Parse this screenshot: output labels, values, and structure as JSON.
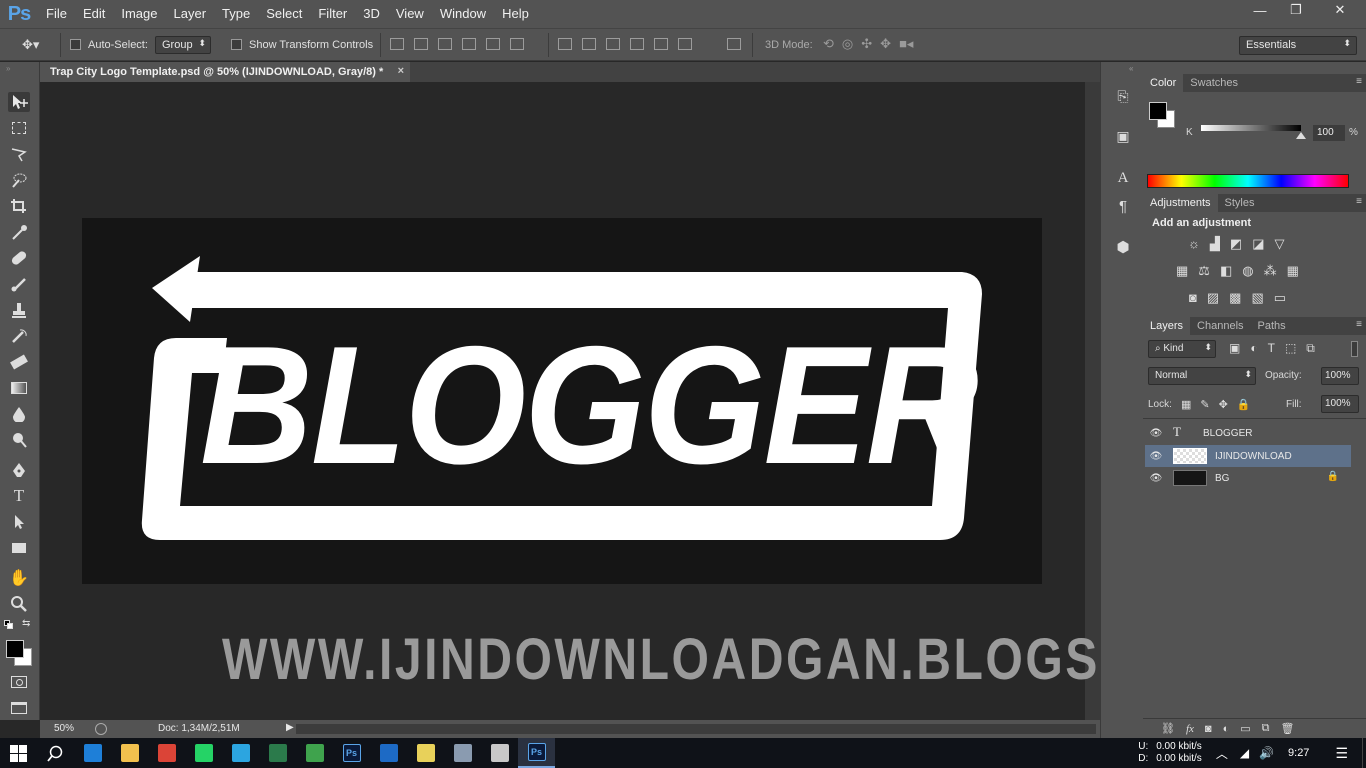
{
  "app": {
    "logo": "Ps"
  },
  "menu": [
    "File",
    "Edit",
    "Image",
    "Layer",
    "Type",
    "Select",
    "Filter",
    "3D",
    "View",
    "Window",
    "Help"
  ],
  "window_controls": {
    "minimize": "—",
    "restore": "❐",
    "close": "✕"
  },
  "options_bar": {
    "auto_select_label": "Auto-Select:",
    "auto_select_value": "Group",
    "show_transform_label": "Show Transform Controls",
    "mode_3d_label": "3D Mode:",
    "workspace": "Essentials"
  },
  "document": {
    "tab_title": "Trap City Logo Template.psd @ 50% (IJINDOWNLOAD, Gray/8) *",
    "tab_close": "×",
    "logo_text": "BLOGGER",
    "watermark": "WWW.IJINDOWNLOADGAN.BLOGSPOT.COM"
  },
  "status_bar": {
    "zoom": "50%",
    "doc_info": "Doc: 1,34M/2,51M"
  },
  "color_panel": {
    "tabs": [
      "Color",
      "Swatches"
    ],
    "channel": "K",
    "value": "100",
    "unit": "%",
    "foreground": "#000000",
    "background": "#ffffff"
  },
  "adjustments_panel": {
    "tabs": [
      "Adjustments",
      "Styles"
    ],
    "heading": "Add an adjustment"
  },
  "layers_panel": {
    "tabs": [
      "Layers",
      "Channels",
      "Paths"
    ],
    "filter_kind": "Kind",
    "blend_mode": "Normal",
    "opacity_label": "Opacity:",
    "opacity": "100%",
    "lock_label": "Lock:",
    "fill_label": "Fill:",
    "fill": "100%",
    "layers": [
      {
        "name": "BLOGGER",
        "kind": "text",
        "thumb": "T",
        "selected": false,
        "locked": false
      },
      {
        "name": "IJINDOWNLOAD",
        "kind": "image",
        "thumb": "",
        "selected": true,
        "locked": false
      },
      {
        "name": "BG",
        "kind": "image",
        "thumb": "",
        "selected": false,
        "locked": true
      }
    ],
    "footer_fx": "fx"
  },
  "taskbar": {
    "network_up_label": "U:",
    "network_down_label": "D:",
    "network_up": "0.00 kbit/s",
    "network_down": "0.00 kbit/s",
    "time": "9:27",
    "pinned": [
      {
        "name": "search",
        "color": "#0f1218"
      },
      {
        "name": "edge",
        "color": "#1e7fd8"
      },
      {
        "name": "file-explorer",
        "color": "#f2c14e"
      },
      {
        "name": "chrome",
        "color": "#db4437"
      },
      {
        "name": "whatsapp",
        "color": "#25d366"
      },
      {
        "name": "telegram",
        "color": "#2ca5e0"
      },
      {
        "name": "media-app",
        "color": "#2b7a4b"
      },
      {
        "name": "colorful-app",
        "color": "#3fa34d"
      },
      {
        "name": "photoshop-1",
        "color": "#0a1a3a"
      },
      {
        "name": "app-blue",
        "color": "#1d6ac5"
      },
      {
        "name": "notepad",
        "color": "#e8d15a"
      },
      {
        "name": "network-app",
        "color": "#8a9bb0"
      },
      {
        "name": "paint-app",
        "color": "#c8c8c8"
      },
      {
        "name": "photoshop-2",
        "color": "#0a1a3a"
      }
    ]
  },
  "colors": {
    "accent_ps": "#5aa4e8",
    "selected_layer": "#5e718a"
  }
}
